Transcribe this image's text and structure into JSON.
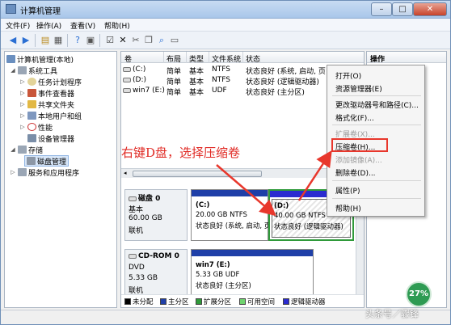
{
  "window": {
    "title": "计算机管理"
  },
  "menu": [
    "文件(F)",
    "操作(A)",
    "查看(V)",
    "帮助(H)"
  ],
  "tree": [
    {
      "label": "计算机管理(本地)"
    },
    {
      "label": "系统工具"
    },
    {
      "label": "任务计划程序"
    },
    {
      "label": "事件查看器"
    },
    {
      "label": "共享文件夹"
    },
    {
      "label": "本地用户和组"
    },
    {
      "label": "性能"
    },
    {
      "label": "设备管理器"
    },
    {
      "label": "存储"
    },
    {
      "label": "磁盘管理"
    },
    {
      "label": "服务和应用程序"
    }
  ],
  "volume_table": {
    "headers": [
      "卷",
      "布局",
      "类型",
      "文件系统",
      "状态"
    ],
    "rows": [
      {
        "volume": "(C:)",
        "layout": "简单",
        "type": "基本",
        "fs": "NTFS",
        "status": "状态良好 (系统, 启动, 页"
      },
      {
        "volume": "(D:)",
        "layout": "简单",
        "type": "基本",
        "fs": "NTFS",
        "status": "状态良好 (逻辑驱动器)"
      },
      {
        "volume": "win7 (E:)",
        "layout": "简单",
        "type": "基本",
        "fs": "UDF",
        "status": "状态良好 (主分区)"
      }
    ]
  },
  "disks": [
    {
      "name": "磁盘 0",
      "type": "基本",
      "size": "60.00 GB",
      "state": "联机"
    },
    {
      "name": "CD-ROM 0",
      "type": "DVD",
      "size": "5.33 GB",
      "state": "联机"
    }
  ],
  "partitions": {
    "c": {
      "name": "(C:)",
      "size": "20.00 GB NTFS",
      "status": "状态良好 (系统, 启动, 页"
    },
    "d": {
      "name": "(D:)",
      "size": "40.00 GB NTFS",
      "status": "状态良好 (逻辑驱动器)"
    },
    "e": {
      "name": "win7  (E:)",
      "size": "5.33 GB UDF",
      "status": "状态良好 (主分区)"
    }
  },
  "legend": [
    "未分配",
    "主分区",
    "扩展分区",
    "可用空间",
    "逻辑驱动器"
  ],
  "legend_colors": [
    "#000000",
    "#1f3fa8",
    "#2f9a3a",
    "#6fd36f",
    "#2b2bd0"
  ],
  "actions_header": "操作",
  "context_menu": {
    "open": "打开(O)",
    "explorer": "资源管理器(E)",
    "change_letter": "更改驱动器号和路径(C)...",
    "format": "格式化(F)...",
    "extend": "扩展卷(X)...",
    "shrink": "压缩卷(H)...",
    "mirror": "添加镜像(A)...",
    "delete": "删除卷(D)...",
    "properties": "属性(P)",
    "help": "帮助(H)"
  },
  "annotation": "右键D盘，选择压缩卷",
  "badge": "27%",
  "watermark": "头条号／骤锋",
  "colors": {
    "accent_red": "#e02a24",
    "primary_blue": "#1f3fa8",
    "logical_green": "#2f9a3a"
  }
}
